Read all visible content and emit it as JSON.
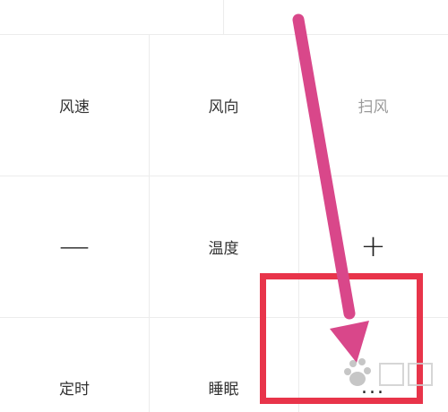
{
  "controls": {
    "wind_speed": "风速",
    "wind_direction": "风向",
    "swing": "扫风",
    "temp_down": "—",
    "temperature": "温度",
    "temp_up": "+",
    "timer": "定时",
    "sleep": "睡眠",
    "more": "..."
  },
  "annotation": {
    "arrow_color": "#d9478a",
    "box_color": "#e8344a"
  },
  "icons": {
    "watermark": "baidu-jingyan-watermark"
  }
}
